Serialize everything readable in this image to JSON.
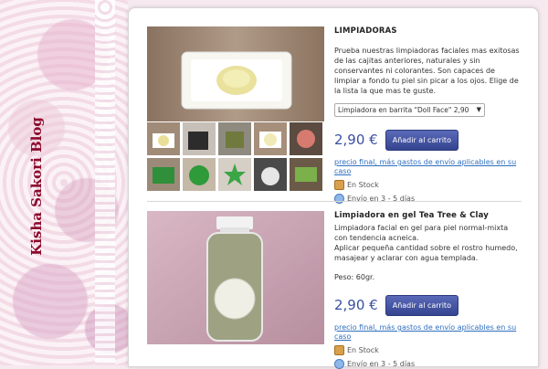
{
  "blog": {
    "title": "Kisha Sakori Blog"
  },
  "products": [
    {
      "title": "LIMPIADORAS",
      "description": "Prueba nuestras limpiadoras faciales mas exitosas de las cajitas anteriores, naturales y sin conservantes ni colorantes. Son capaces de limpiar a fondo tu piel sin picar a los ojos. Elige de la lista la que mas te guste.",
      "select_value": "Limpiadora en barrita \"Doll Face\" 2,90",
      "price": "2,90 €",
      "buy_label": "Añadir al carrito",
      "shipping_link": "precio final, más gastos de envío aplicables en su caso",
      "stock": "En Stock",
      "delivery": "Envío en 3 - 5 días"
    },
    {
      "title": "Limpiadora en gel Tea Tree & Clay",
      "description_lines": [
        "Limpiadora facial en gel para piel normal-mixta con tendencia acneica.",
        "Aplicar pequeña cantidad sobre el rostro humedo, masajear y aclarar con agua templada."
      ],
      "weight": "Peso: 60gr.",
      "price": "2,90 €",
      "buy_label": "Añadir al carrito",
      "shipping_link": "precio final, más gastos de envío aplicables en su caso",
      "stock": "En Stock",
      "delivery": "Envío en 3 - 5 días"
    }
  ]
}
